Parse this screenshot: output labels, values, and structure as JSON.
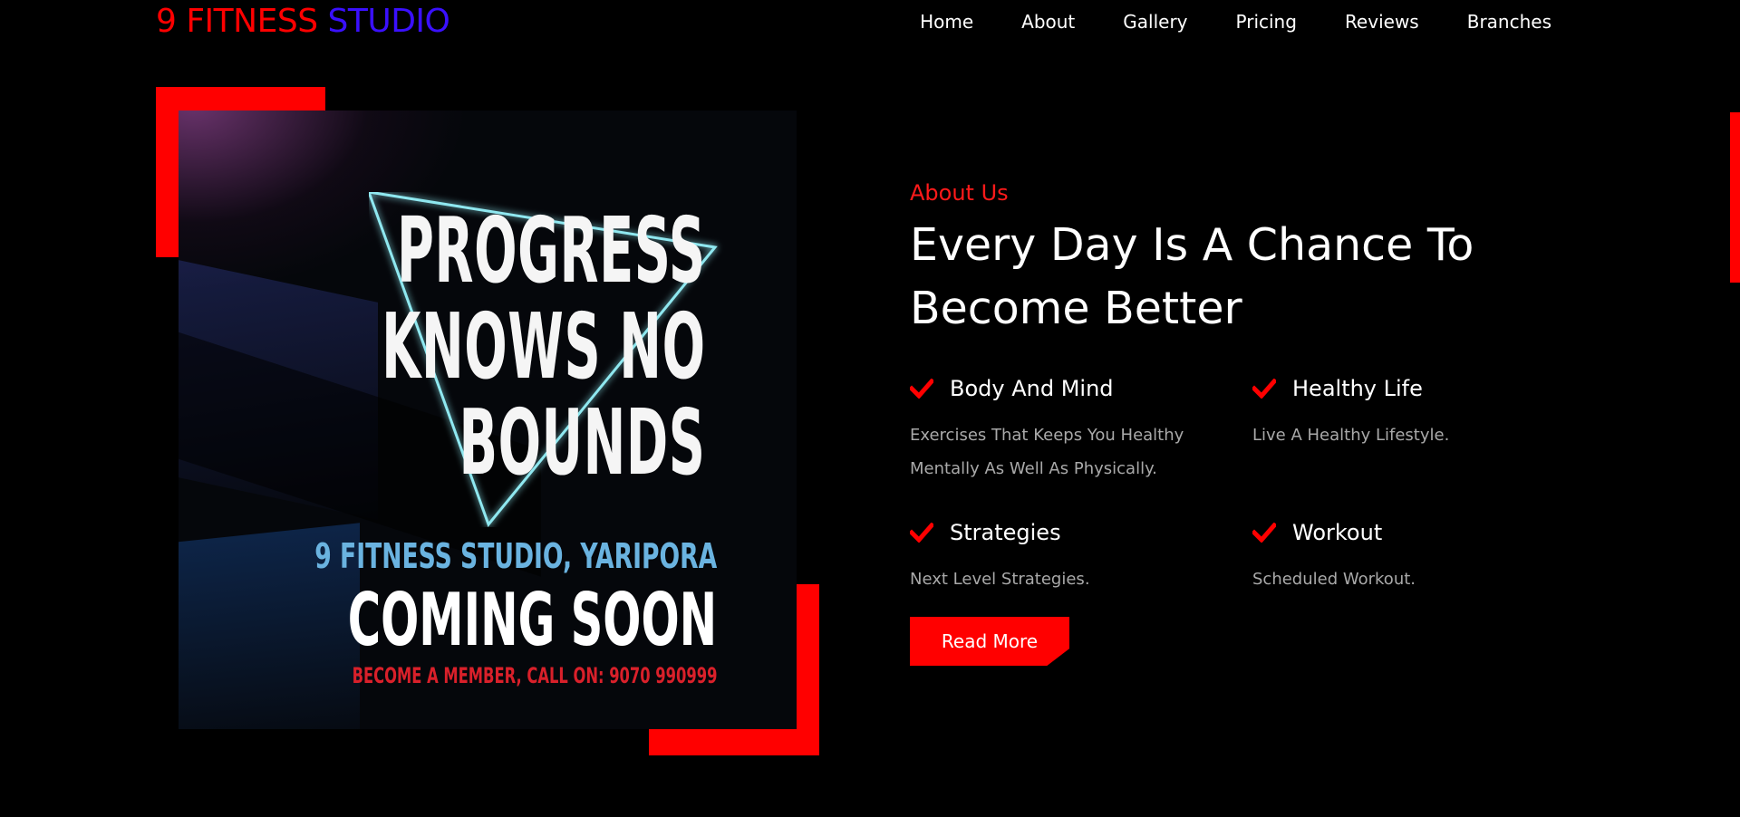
{
  "brand": {
    "part1": "9 FITNESS",
    "part2": "STUDIO",
    "colors": {
      "part1": "#ff0000",
      "part2": "#3a10ff"
    }
  },
  "nav": {
    "items": [
      {
        "label": "Home"
      },
      {
        "label": "About"
      },
      {
        "label": "Gallery"
      },
      {
        "label": "Pricing"
      },
      {
        "label": "Reviews"
      },
      {
        "label": "Branches"
      }
    ]
  },
  "poster": {
    "headline_line1": "PROGRESS",
    "headline_line2": "KNOWS NO",
    "headline_line3": "BOUNDS",
    "subheading": "9 FITNESS STUDIO, YARIPORA",
    "coming": "COMING SOON",
    "member": "BECOME A MEMBER, CALL ON: 9070 990999"
  },
  "about": {
    "label": "About Us",
    "heading": "Every Day Is A Chance To Become Better",
    "features": [
      {
        "title": "Body And Mind",
        "desc": "Exercises That Keeps You Healthy Mentally As Well As Physically.",
        "icon": "check-icon"
      },
      {
        "title": "Healthy Life",
        "desc": "Live A Healthy Lifestyle.",
        "icon": "check-icon"
      },
      {
        "title": "Strategies",
        "desc": "Next Level Strategies.",
        "icon": "check-icon"
      },
      {
        "title": "Workout",
        "desc": "Scheduled Workout.",
        "icon": "check-icon"
      }
    ],
    "button": "Read More"
  },
  "theme": {
    "accent": "#ff0000",
    "background": "#000000",
    "muted_text": "#a9a9a9"
  }
}
